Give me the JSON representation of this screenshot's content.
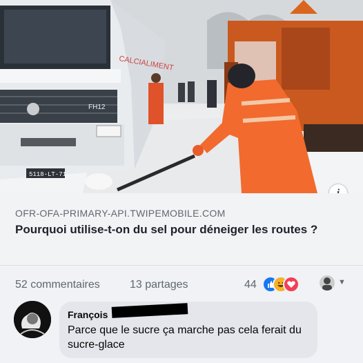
{
  "post": {
    "link_domain": "OFR-OFA-PRIMARY-API.TWIPEMOBILE.COM",
    "headline": "Pourquoi utilise-t-on du sel pour déneiger les routes ?",
    "info_icon": "i"
  },
  "stats": {
    "comments": "52 commentaires",
    "shares": "13 partages",
    "reaction_count": "44",
    "reaction_icons": [
      "like-icon",
      "haha-icon",
      "wow-icon"
    ]
  },
  "comment": {
    "author_visible": "François",
    "text": "Parce que le sucre ça marche pas cela ferait du sucre-glace"
  },
  "photo": {
    "truck_model": "FH12",
    "plate": "5118-LT-71"
  },
  "colors": {
    "like": "#1877f2",
    "haha": "#f7b125",
    "wow": "#f33e58",
    "bubble": "#e4e6eb",
    "worker": "#f26a2e"
  }
}
